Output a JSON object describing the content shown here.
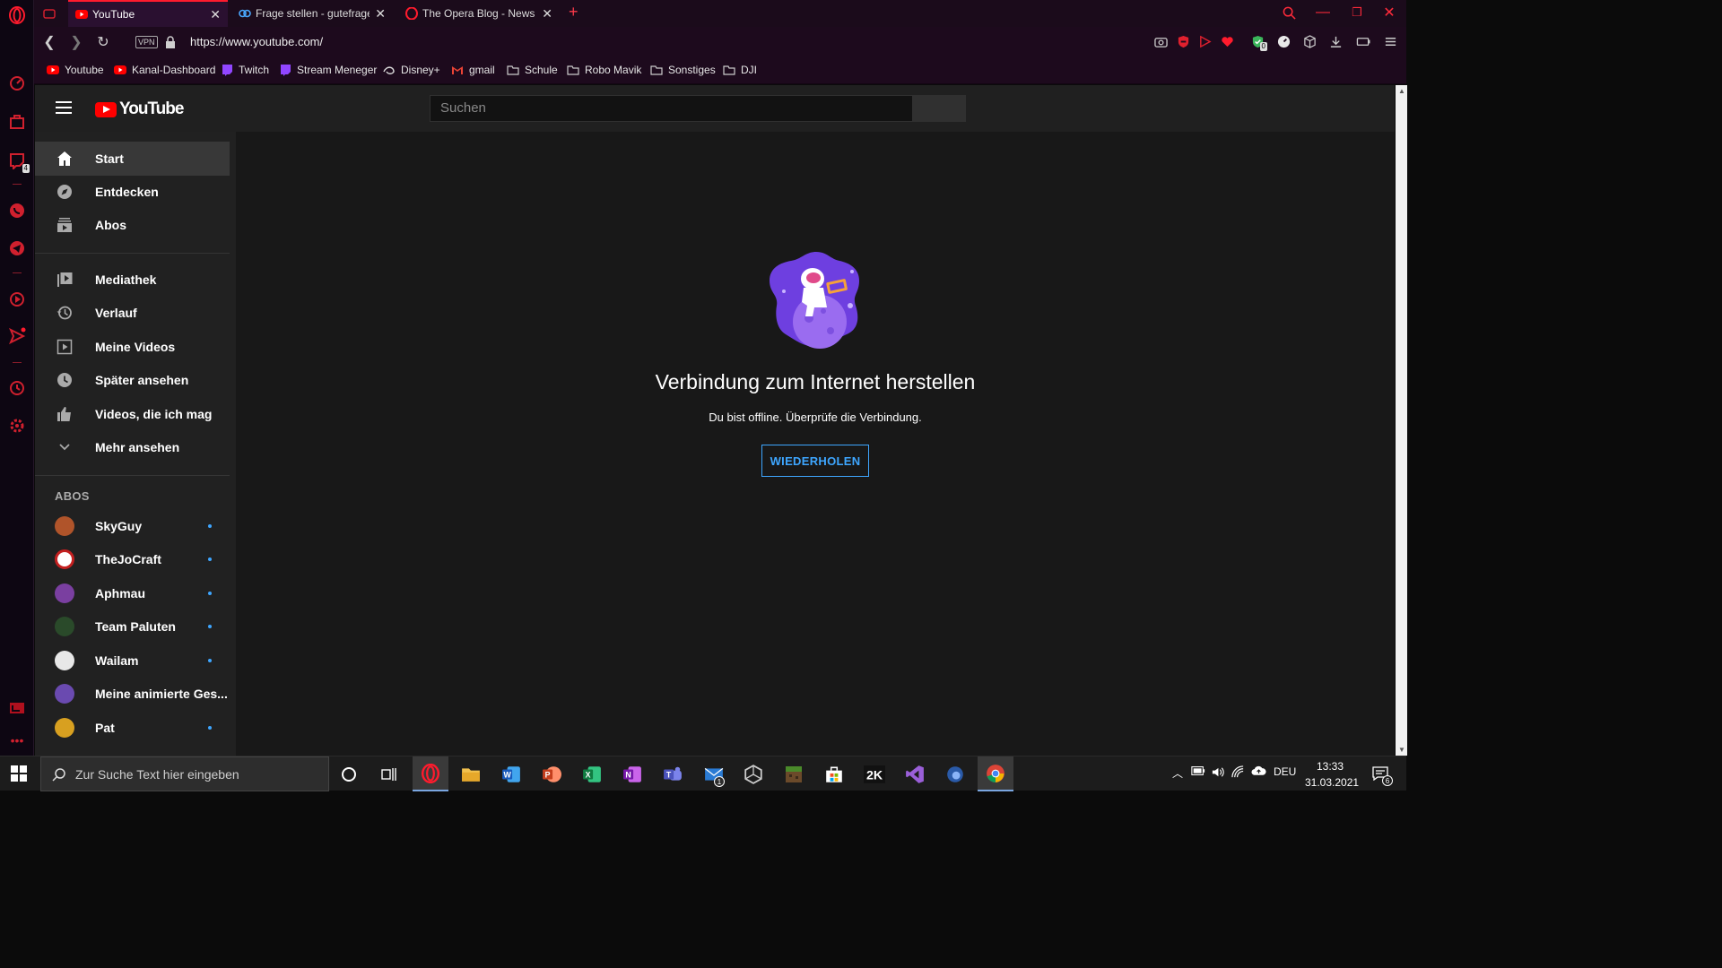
{
  "browser": {
    "tabs": [
      {
        "title": "YouTube",
        "active": true
      },
      {
        "title": "Frage stellen - gutefrage",
        "active": false
      },
      {
        "title": "The Opera Blog - News | O",
        "active": false
      }
    ],
    "url": "https://www.youtube.com/",
    "vpn_label": "VPN",
    "bookmarks": [
      "Youtube",
      "Kanal-Dashboard",
      "Twitch",
      "Stream Meneger",
      "Disney+",
      "gmail",
      "Schule",
      "Robo Mavik",
      "Sonstiges",
      "DJI"
    ],
    "sidebar_badge": "4",
    "ext_badge": "0"
  },
  "youtube": {
    "logo": "YouTube",
    "search_placeholder": "Suchen",
    "nav": [
      {
        "label": "Start",
        "icon": "home-icon",
        "selected": true
      },
      {
        "label": "Entdecken",
        "icon": "compass-icon"
      },
      {
        "label": "Abos",
        "icon": "subscriptions-icon"
      }
    ],
    "library": [
      {
        "label": "Mediathek",
        "icon": "library-icon"
      },
      {
        "label": "Verlauf",
        "icon": "history-icon"
      },
      {
        "label": "Meine Videos",
        "icon": "my-videos-icon"
      },
      {
        "label": "Später ansehen",
        "icon": "watch-later-icon"
      },
      {
        "label": "Videos, die ich mag",
        "icon": "thumbs-up-icon"
      },
      {
        "label": "Mehr ansehen",
        "icon": "chevron-down-icon"
      }
    ],
    "subs_header": "ABOS",
    "subscriptions": [
      {
        "name": "SkyGuy",
        "new": true,
        "color": "#b0542a"
      },
      {
        "name": "TheJoCraft",
        "new": true,
        "color": "#c42020"
      },
      {
        "name": "Aphmau",
        "new": true,
        "color": "#7a3fa0"
      },
      {
        "name": "Team Paluten",
        "new": true,
        "color": "#2a4a2a"
      },
      {
        "name": "Wailam",
        "new": true,
        "color": "#e8e8e8"
      },
      {
        "name": "Meine animierte Ges...",
        "new": false,
        "color": "#6a4ab0"
      },
      {
        "name": "Pat",
        "new": true,
        "color": "#d8a020"
      }
    ],
    "offline": {
      "title": "Verbindung zum Internet herstellen",
      "subtitle": "Du bist offline. Überprüfe die Verbindung.",
      "retry": "WIEDERHOLEN"
    }
  },
  "taskbar": {
    "search_placeholder": "Zur Suche Text hier eingeben",
    "mail_badge": "1",
    "lang": "DEU",
    "time": "13:33",
    "date": "31.03.2021",
    "notifications": "6"
  },
  "colors": {
    "opera_red": "#ff1b2d",
    "yt_red": "#ff0000",
    "link_blue": "#3ea6ff"
  }
}
